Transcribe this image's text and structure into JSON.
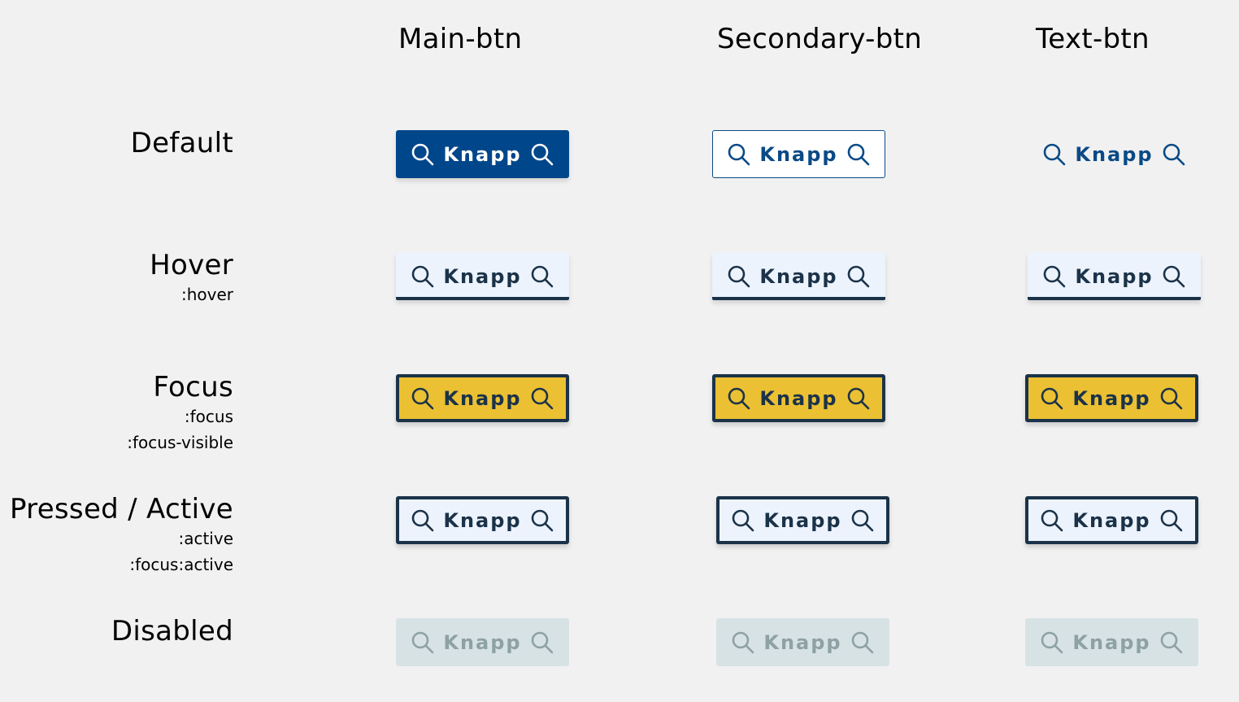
{
  "columns": {
    "main": "Main-btn",
    "secondary": "Secondary-btn",
    "text": "Text-btn"
  },
  "rows": {
    "default": {
      "title": "Default"
    },
    "hover": {
      "title": "Hover",
      "sub1": ":hover"
    },
    "focus": {
      "title": "Focus",
      "sub1": ":focus",
      "sub2": ":focus-visible"
    },
    "active": {
      "title": "Pressed / Active",
      "sub1": ":active",
      "sub2": ":focus:active"
    },
    "disabled": {
      "title": "Disabled"
    }
  },
  "button": {
    "label": "Knapp",
    "icon": "search-icon"
  },
  "colors": {
    "background": "#f1f1f1",
    "primary_blue": "#00468b",
    "secondary_text": "#0a4a86",
    "dark_border": "#1b3349",
    "hover_bg": "#edf3fc",
    "focus_yellow": "#ebc032",
    "disabled_bg": "#d7e2e4",
    "disabled_text": "#8ea1a5"
  }
}
